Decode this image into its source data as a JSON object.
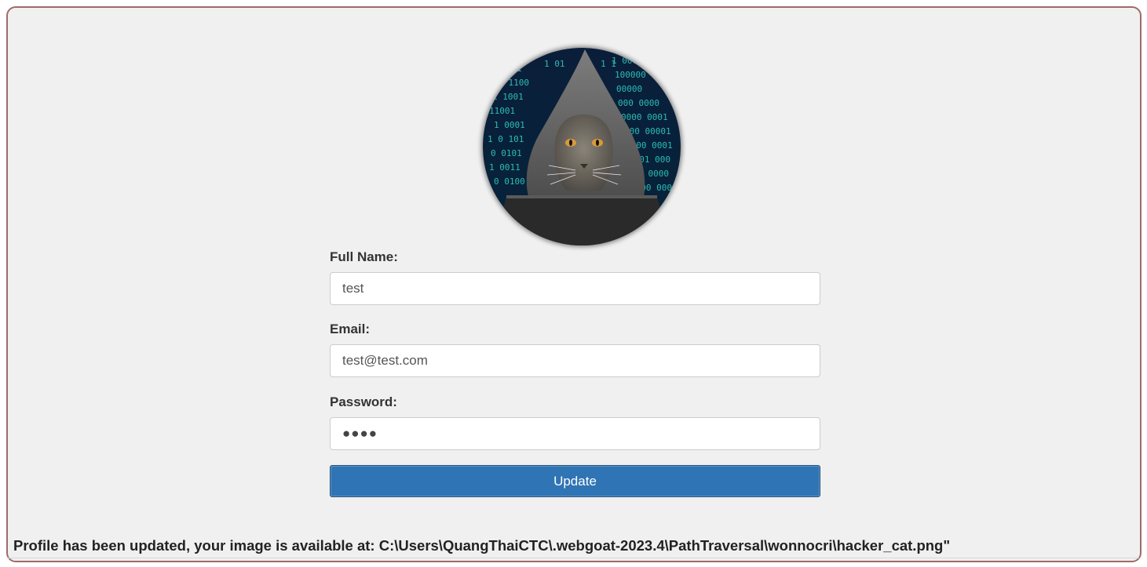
{
  "profile": {
    "image_alt": "hacker cat"
  },
  "form": {
    "full_name_label": "Full Name:",
    "full_name_value": "test",
    "email_label": "Email:",
    "email_value": "test@test.com",
    "password_label": "Password:",
    "password_display": "●●●●",
    "update_button": "Update"
  },
  "status": {
    "message": "Profile has been updated, your image is available at: C:\\Users\\QuangThaiCTC\\.webgoat-2023.4\\PathTraversal\\wonnocri\\hacker_cat.png\""
  },
  "colors": {
    "frame_border": "#a06a6a",
    "background": "#f0f0f0",
    "button": "#2f74b4"
  }
}
